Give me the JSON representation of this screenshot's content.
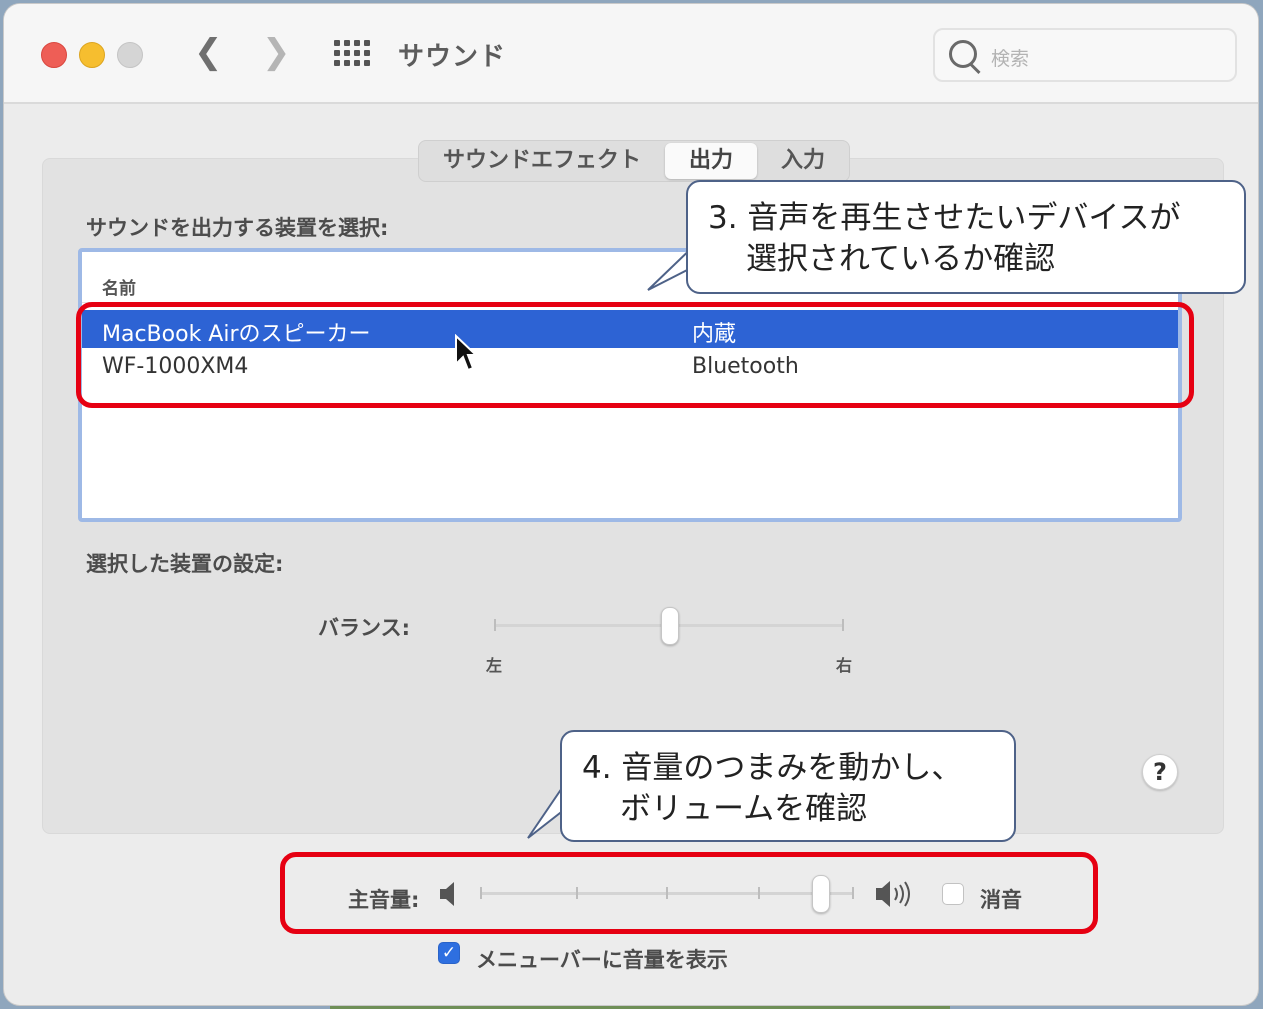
{
  "window": {
    "title": "サウンド",
    "search_placeholder": "検索"
  },
  "tabs": [
    {
      "label": "サウンドエフェクト",
      "active": false
    },
    {
      "label": "出力",
      "active": true
    },
    {
      "label": "入力",
      "active": false
    }
  ],
  "output": {
    "select_label": "サウンドを出力する装置を選択:",
    "column_name": "名前",
    "devices": [
      {
        "name": "MacBook Airのスピーカー",
        "type": "内蔵",
        "selected": true
      },
      {
        "name": "WF-1000XM4",
        "type": "Bluetooth",
        "selected": false
      }
    ],
    "settings_label": "選択した装置の設定:",
    "balance": {
      "label": "バランス:",
      "left_label": "左",
      "right_label": "右",
      "value": 0.5
    }
  },
  "help_label": "?",
  "volume": {
    "label": "主音量:",
    "value": 0.91,
    "mute_label": "消音",
    "mute_checked": false,
    "menubar_label": "メニューバーに音量を表示",
    "menubar_checked": true
  },
  "annotations": {
    "callout3": {
      "line1": "3. 音声を再生させたいデバイスが",
      "line2": "選択されているか確認"
    },
    "callout4": {
      "line1": "4. 音量のつまみを動かし、",
      "line2": "ボリュームを確認"
    },
    "highlight_color": "#e60012"
  }
}
